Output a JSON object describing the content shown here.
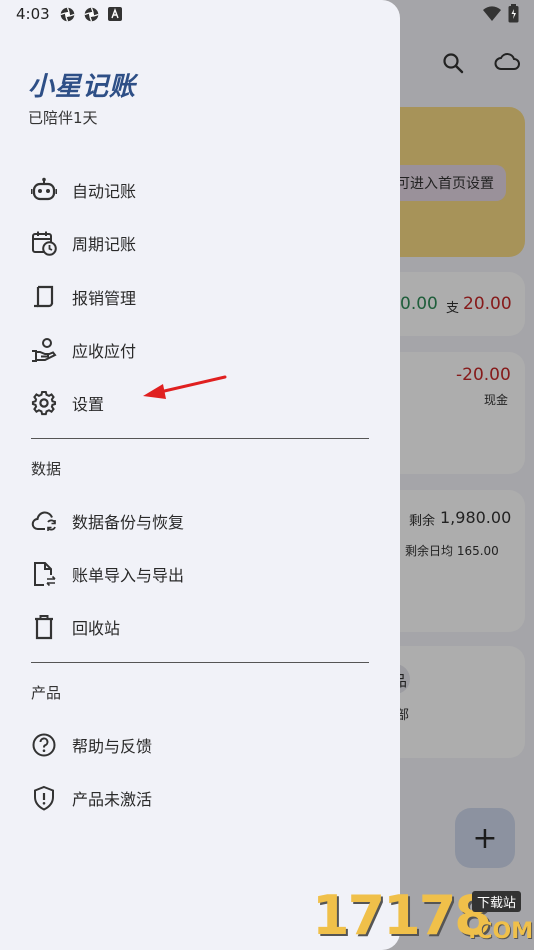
{
  "status_bar": {
    "time": "4:03"
  },
  "drawer": {
    "app_title": "小星记账",
    "subtitle": "已陪伴1天",
    "items_main": [
      {
        "label": "自动记账",
        "icon": "robot-icon"
      },
      {
        "label": "周期记账",
        "icon": "calendar-clock-icon"
      },
      {
        "label": "报销管理",
        "icon": "receipt-icon"
      },
      {
        "label": "应收应付",
        "icon": "hand-money-icon"
      },
      {
        "label": "设置",
        "icon": "gear-icon"
      }
    ],
    "section_data": "数据",
    "items_data": [
      {
        "label": "数据备份与恢复",
        "icon": "cloud-sync-icon"
      },
      {
        "label": "账单导入与导出",
        "icon": "file-transfer-icon"
      },
      {
        "label": "回收站",
        "icon": "trash-icon"
      }
    ],
    "section_product": "产品",
    "items_product": [
      {
        "label": "帮助与反馈",
        "icon": "help-circle-icon"
      },
      {
        "label": "产品未激活",
        "icon": "shield-alert-icon"
      }
    ]
  },
  "background": {
    "banner_hint": "可进入首页设置",
    "income": "0.00",
    "expense_label": "支",
    "expense": "20.00",
    "txn_amount": "-20.00",
    "txn_account": "现金",
    "remaining_label": "剩余",
    "remaining": "1,980.00",
    "daily_avg": "剩余日均 165.00",
    "partial_char_1": "品",
    "partial_char_2": "部",
    "fab": "+"
  },
  "watermark": {
    "number": "17178",
    "badge": "下载站",
    "domain": ".COM"
  },
  "colors": {
    "title": "#2e4f86",
    "income": "#2e8b57",
    "expense": "#c62828",
    "arrow": "#e02020"
  }
}
